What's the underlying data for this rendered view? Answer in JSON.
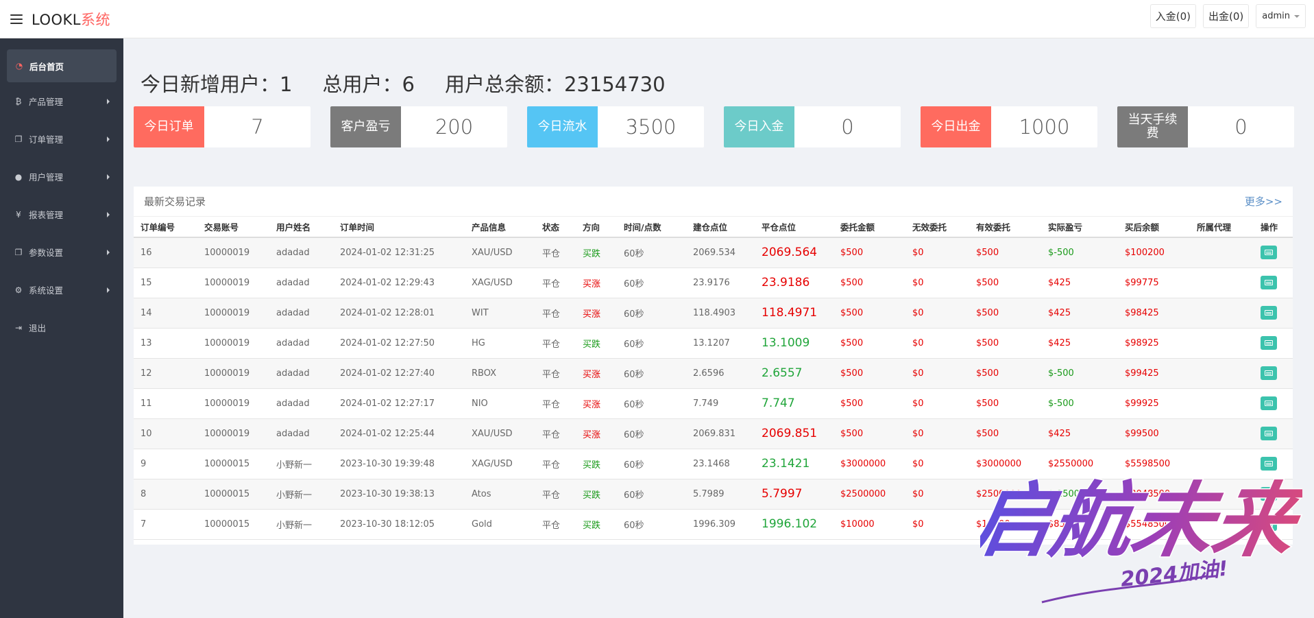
{
  "brand": {
    "main": "LOOKL",
    "sub": "系统"
  },
  "topbar": {
    "deposit_btn": "入金(0)",
    "withdraw_btn": "出金(0)",
    "user": "admin"
  },
  "sidebar": {
    "items": [
      {
        "label": "后台首页",
        "icon": "dashboard-icon"
      },
      {
        "label": "产品管理",
        "icon": "bitcoin-icon"
      },
      {
        "label": "订单管理",
        "icon": "copy-icon"
      },
      {
        "label": "用户管理",
        "icon": "user-icon"
      },
      {
        "label": "报表管理",
        "icon": "yen-icon"
      },
      {
        "label": "参数设置",
        "icon": "copy-icon"
      },
      {
        "label": "系统设置",
        "icon": "gears-icon"
      },
      {
        "label": "退出",
        "icon": "sign-out-icon"
      }
    ]
  },
  "stats": {
    "new_users_label": "今日新增用户：",
    "new_users": "1",
    "total_users_label": "总用户：",
    "total_users": "6",
    "balance_label": "用户总余额：",
    "balance": "23154730"
  },
  "cards": [
    {
      "label": "今日订单",
      "value": "7",
      "color": "#ff6b5f"
    },
    {
      "label": "客户盈亏",
      "value": "200",
      "color": "#7b7b7b"
    },
    {
      "label": "今日流水",
      "value": "3500",
      "color": "#55c5f4"
    },
    {
      "label": "今日入金",
      "value": "0",
      "color": "#6ccbc9"
    },
    {
      "label": "今日出金",
      "value": "1000",
      "color": "#ff6b5f"
    },
    {
      "label": "当天手续费",
      "value": "0",
      "color": "#7b7b7b"
    }
  ],
  "panel": {
    "title": "最新交易记录",
    "more": "更多>>"
  },
  "table": {
    "headers": [
      "订单编号",
      "交易账号",
      "用户姓名",
      "订单时间",
      "产品信息",
      "状态",
      "方向",
      "时间/点数",
      "建仓点位",
      "平仓点位",
      "委托金额",
      "无效委托",
      "有效委托",
      "实际盈亏",
      "买后余额",
      "所属代理",
      "操作"
    ],
    "rows": [
      {
        "id": "16",
        "account": "10000019",
        "name": "adadad",
        "time": "2024-01-02 12:31:25",
        "product": "XAU/USD",
        "status": "平仓",
        "dir": "买跌",
        "dir_up": false,
        "period": "60秒",
        "open": "2069.534",
        "close": "2069.564",
        "close_up": true,
        "amount": "$500",
        "invalid": "$0",
        "valid": "$500",
        "pnl": "$-500",
        "pnl_neg": true,
        "balance": "$100200",
        "agent": ""
      },
      {
        "id": "15",
        "account": "10000019",
        "name": "adadad",
        "time": "2024-01-02 12:29:43",
        "product": "XAG/USD",
        "status": "平仓",
        "dir": "买涨",
        "dir_up": true,
        "period": "60秒",
        "open": "23.9176",
        "close": "23.9186",
        "close_up": true,
        "amount": "$500",
        "invalid": "$0",
        "valid": "$500",
        "pnl": "$425",
        "pnl_neg": false,
        "balance": "$99775",
        "agent": ""
      },
      {
        "id": "14",
        "account": "10000019",
        "name": "adadad",
        "time": "2024-01-02 12:28:01",
        "product": "WIT",
        "status": "平仓",
        "dir": "买涨",
        "dir_up": true,
        "period": "60秒",
        "open": "118.4903",
        "close": "118.4971",
        "close_up": true,
        "amount": "$500",
        "invalid": "$0",
        "valid": "$500",
        "pnl": "$425",
        "pnl_neg": false,
        "balance": "$98425",
        "agent": ""
      },
      {
        "id": "13",
        "account": "10000019",
        "name": "adadad",
        "time": "2024-01-02 12:27:50",
        "product": "HG",
        "status": "平仓",
        "dir": "买跌",
        "dir_up": false,
        "period": "60秒",
        "open": "13.1207",
        "close": "13.1009",
        "close_up": false,
        "amount": "$500",
        "invalid": "$0",
        "valid": "$500",
        "pnl": "$425",
        "pnl_neg": false,
        "balance": "$98925",
        "agent": ""
      },
      {
        "id": "12",
        "account": "10000019",
        "name": "adadad",
        "time": "2024-01-02 12:27:40",
        "product": "RBOX",
        "status": "平仓",
        "dir": "买涨",
        "dir_up": true,
        "period": "60秒",
        "open": "2.6596",
        "close": "2.6557",
        "close_up": false,
        "amount": "$500",
        "invalid": "$0",
        "valid": "$500",
        "pnl": "$-500",
        "pnl_neg": true,
        "balance": "$99425",
        "agent": ""
      },
      {
        "id": "11",
        "account": "10000019",
        "name": "adadad",
        "time": "2024-01-02 12:27:17",
        "product": "NIO",
        "status": "平仓",
        "dir": "买涨",
        "dir_up": true,
        "period": "60秒",
        "open": "7.749",
        "close": "7.747",
        "close_up": false,
        "amount": "$500",
        "invalid": "$0",
        "valid": "$500",
        "pnl": "$-500",
        "pnl_neg": true,
        "balance": "$99925",
        "agent": ""
      },
      {
        "id": "10",
        "account": "10000019",
        "name": "adadad",
        "time": "2024-01-02 12:25:44",
        "product": "XAU/USD",
        "status": "平仓",
        "dir": "买涨",
        "dir_up": true,
        "period": "60秒",
        "open": "2069.831",
        "close": "2069.851",
        "close_up": true,
        "amount": "$500",
        "invalid": "$0",
        "valid": "$500",
        "pnl": "$425",
        "pnl_neg": false,
        "balance": "$99500",
        "agent": ""
      },
      {
        "id": "9",
        "account": "10000015",
        "name": "小野新一",
        "time": "2023-10-30 19:39:48",
        "product": "XAG/USD",
        "status": "平仓",
        "dir": "买跌",
        "dir_up": false,
        "period": "60秒",
        "open": "23.1468",
        "close": "23.1421",
        "close_up": false,
        "amount": "$3000000",
        "invalid": "$0",
        "valid": "$3000000",
        "pnl": "$2550000",
        "pnl_neg": false,
        "balance": "$5598500",
        "agent": ""
      },
      {
        "id": "8",
        "account": "10000015",
        "name": "小野新一",
        "time": "2023-10-30 19:38:13",
        "product": "Atos",
        "status": "平仓",
        "dir": "买跌",
        "dir_up": false,
        "period": "60秒",
        "open": "5.7989",
        "close": "5.7997",
        "close_up": true,
        "amount": "$2500000",
        "invalid": "$0",
        "valid": "$2500000",
        "pnl": "$-2500000",
        "pnl_neg": true,
        "balance": "$3048500",
        "agent": ""
      },
      {
        "id": "7",
        "account": "10000015",
        "name": "小野新一",
        "time": "2023-10-30 18:12:05",
        "product": "Gold",
        "status": "平仓",
        "dir": "买跌",
        "dir_up": false,
        "period": "60秒",
        "open": "1996.309",
        "close": "1996.102",
        "close_up": false,
        "amount": "$10000",
        "invalid": "$0",
        "valid": "$10000",
        "pnl": "$8500",
        "pnl_neg": false,
        "balance": "$5548500",
        "agent": ""
      }
    ]
  },
  "watermark": {
    "text": "启航未来",
    "sub": "2024加油!"
  }
}
